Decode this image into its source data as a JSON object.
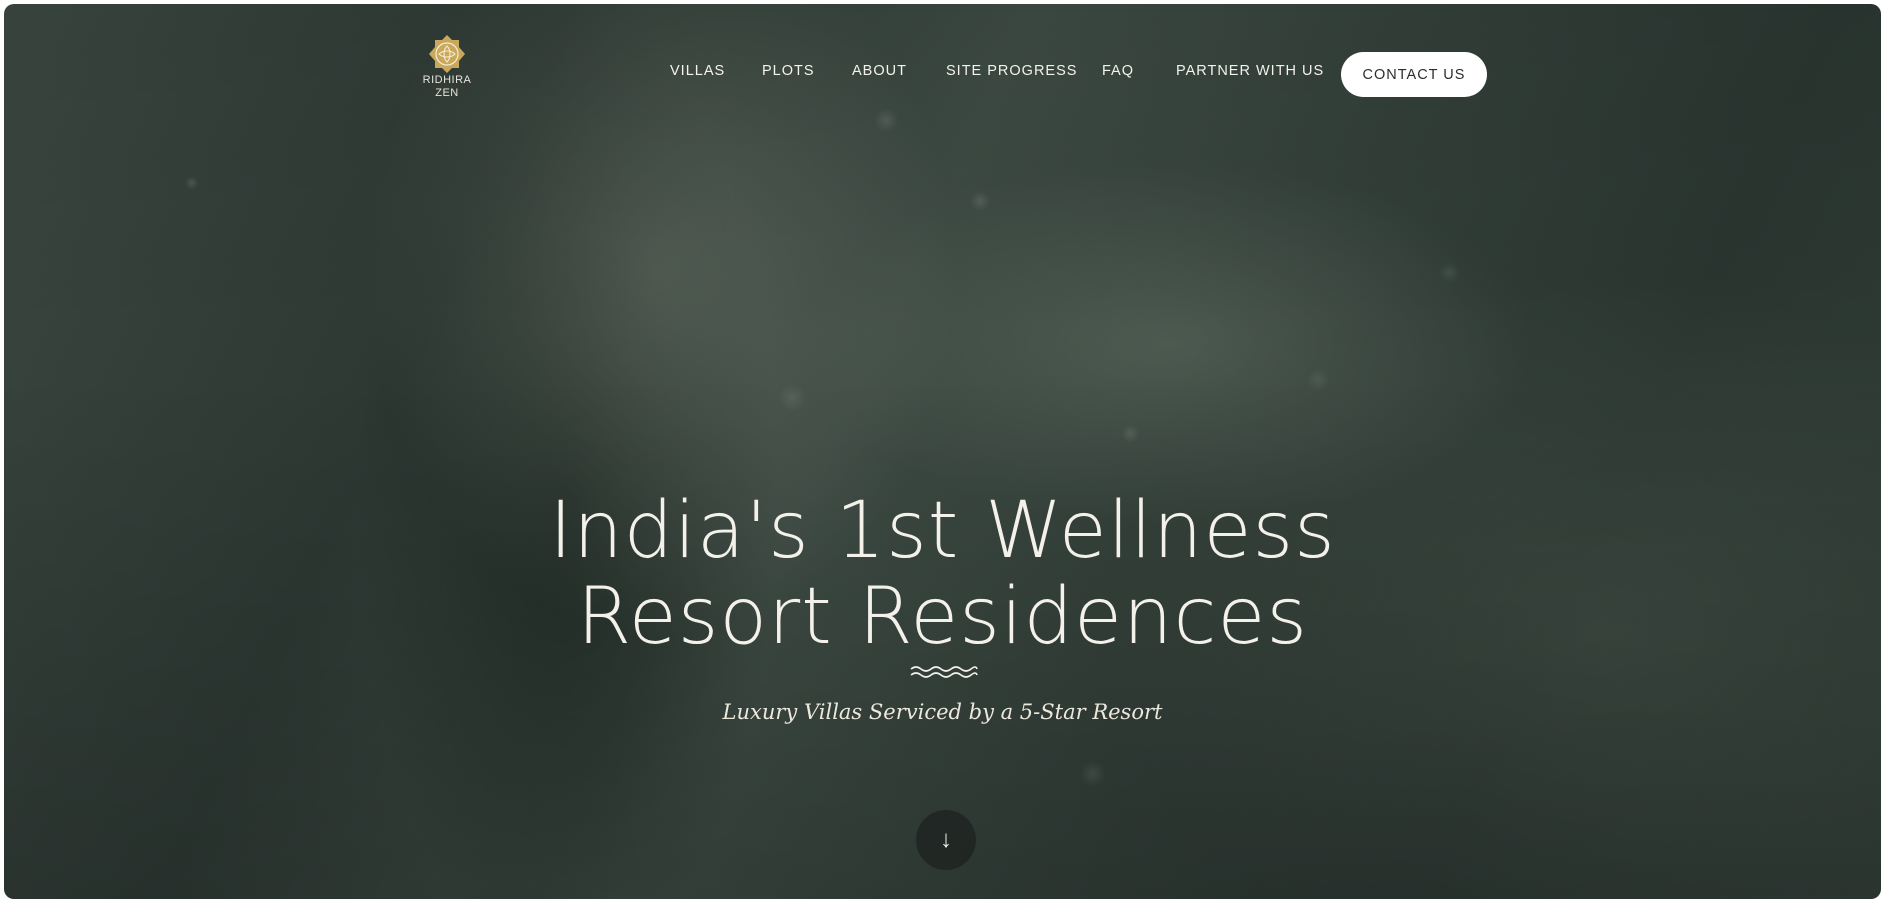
{
  "brand": {
    "name_line1": "RIDHIRA",
    "name_line2": "ZEN",
    "logo_icon": "lotus-medallion-icon",
    "logo_color": "#c9a85c"
  },
  "nav": {
    "items": [
      {
        "label": "VILLAS"
      },
      {
        "label": "PLOTS"
      },
      {
        "label": "ABOUT"
      },
      {
        "label": "SITE PROGRESS"
      },
      {
        "label": "FAQ"
      },
      {
        "label": "PARTNER WITH US"
      }
    ],
    "cta_label": "CONTACT US"
  },
  "hero": {
    "title_line1": "India's 1st Wellness",
    "title_line2": "Resort Residences",
    "divider_icon": "wave-divider-icon",
    "subtitle": "Luxury Villas Serviced by a 5-Star Resort",
    "scroll_icon": "arrow-down-icon",
    "scroll_glyph": "↓",
    "background": "water-droplets-on-dark-green-leaf"
  },
  "colors": {
    "text": "#f3f1ea",
    "cta_bg": "#ffffff",
    "cta_text": "#2a2f2b",
    "bg_dark_green": "#2d3833"
  }
}
